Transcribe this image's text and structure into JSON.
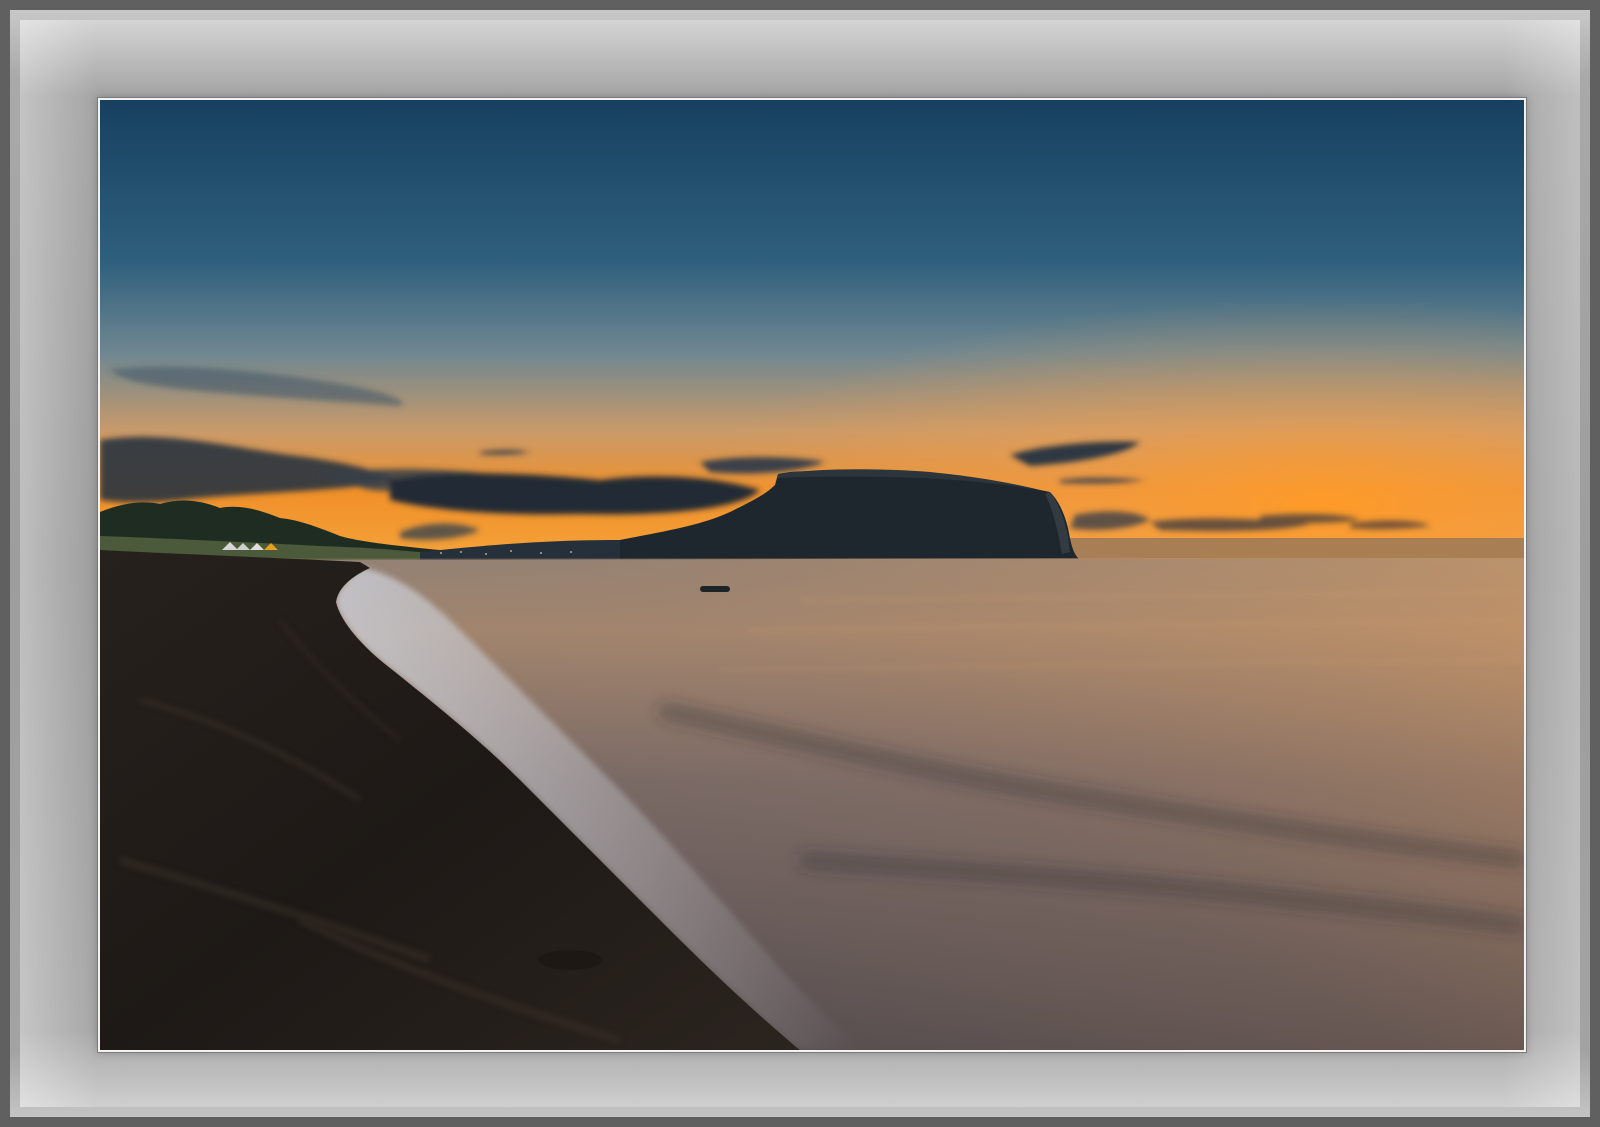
{
  "scene": {
    "subject": "sunset-seascape",
    "colors": {
      "sky_top": "#1a4666",
      "sky_mid": "#3f6a86",
      "horizon_glow": "#f28a1e",
      "headland": "#1f2a30",
      "sand": "#1f1a17",
      "water": "#6d6a6c",
      "frame_mat": "#a0a0a0"
    }
  }
}
